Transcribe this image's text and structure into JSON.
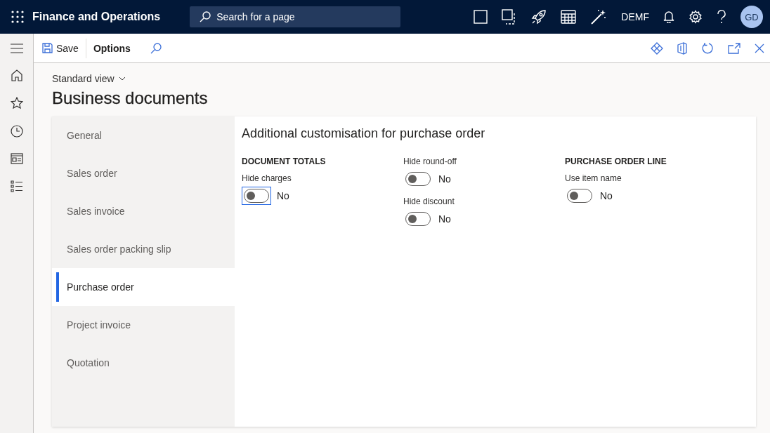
{
  "app": {
    "title": "Finance and Operations",
    "search": {
      "placeholder": "Search for a page"
    },
    "company": "DEMF",
    "avatar": "GD"
  },
  "toolbar": {
    "buttons": [
      "Save",
      "Options"
    ]
  },
  "view": "Standard view",
  "page_title": "Business documents",
  "tabs": [
    {
      "label": "General",
      "selected": false
    },
    {
      "label": "Sales order",
      "selected": false
    },
    {
      "label": "Sales invoice",
      "selected": false
    },
    {
      "label": "Sales order packing slip",
      "selected": false
    },
    {
      "label": "Purchase order",
      "selected": true
    },
    {
      "label": "Project invoice",
      "selected": false
    },
    {
      "label": "Quotation",
      "selected": false
    }
  ],
  "section": {
    "title": "Additional customisation for purchase order",
    "columns": [
      {
        "heading": "DOCUMENT TOTALS",
        "toggles": [
          {
            "label": "Hide charges",
            "on": false,
            "value": "No",
            "focused": true
          }
        ]
      },
      {
        "toggles": [
          {
            "label": "Hide round-off",
            "on": false,
            "value": "No",
            "focused": false
          },
          {
            "label": "Hide discount",
            "on": false,
            "value": "No",
            "focused": false
          }
        ]
      },
      {
        "heading": "PURCHASE ORDER LINE",
        "toggles": [
          {
            "label": "Use item name",
            "on": false,
            "value": "No",
            "focused": false
          }
        ]
      }
    ]
  }
}
